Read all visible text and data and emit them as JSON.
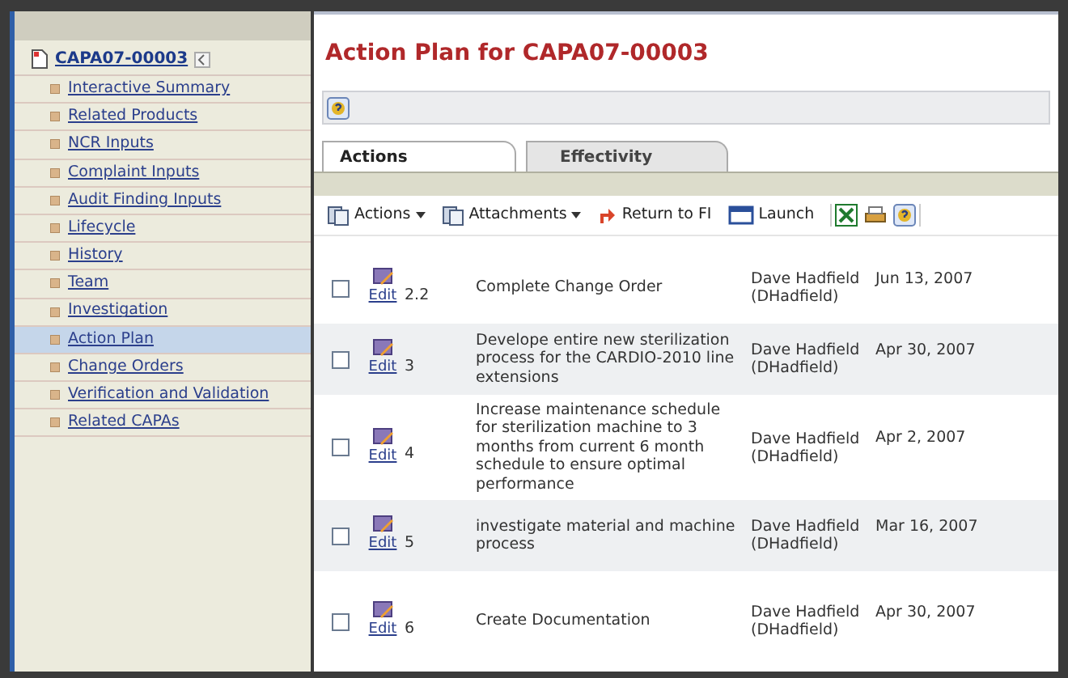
{
  "sidebar": {
    "record": "CAPA07-00003",
    "items": [
      {
        "label": "Interactive Summary",
        "selected": false
      },
      {
        "label": "Related Products",
        "selected": false
      },
      {
        "label": "NCR Inputs",
        "selected": false
      },
      {
        "label": "Complaint Inputs",
        "selected": false
      },
      {
        "label": "Audit Finding Inputs",
        "selected": false
      },
      {
        "label": "Lifecycle",
        "selected": false
      },
      {
        "label": "History",
        "selected": false
      },
      {
        "label": "Team",
        "selected": false
      },
      {
        "label": "Investigation",
        "selected": false
      },
      {
        "label": "Action Plan",
        "selected": true
      },
      {
        "label": "Change Orders",
        "selected": false
      },
      {
        "label": "Verification and Validation",
        "selected": false
      },
      {
        "label": "Related CAPAs",
        "selected": false
      }
    ]
  },
  "title": "Action Plan for CAPA07-00003",
  "tabs": [
    {
      "label": "Actions",
      "selected": true
    },
    {
      "label": "Effectivity",
      "selected": false
    }
  ],
  "toolbar": [
    {
      "label": "Actions",
      "kind": "menu"
    },
    {
      "label": "Attachments",
      "kind": "menu"
    },
    {
      "label": "Return to FI",
      "kind": "return"
    },
    {
      "label": "Launch",
      "kind": "launch"
    }
  ],
  "rows": [
    {
      "checked": false,
      "edit": "Edit",
      "number": "2.2",
      "description": "Complete Change Order",
      "owner": "Dave Hadfield (DHadfield)",
      "date": "Jun 13, 2007"
    },
    {
      "checked": false,
      "edit": "Edit",
      "number": "3",
      "description": "Develope entire new sterilization process for the CARDIO-2010 line extensions",
      "owner": "Dave Hadfield (DHadfield)",
      "date": "Apr 30, 2007"
    },
    {
      "checked": false,
      "edit": "Edit",
      "number": "4",
      "description": "Increase maintenance schedule for sterilization machine to 3 months from current 6 month schedule to ensure optimal performance",
      "owner": "Dave Hadfield (DHadfield)",
      "date": "Apr 2, 2007"
    },
    {
      "checked": false,
      "edit": "Edit",
      "number": "5",
      "description": "investigate material and machine process",
      "owner": "Dave Hadfield (DHadfield)",
      "date": "Mar 16, 2007"
    },
    {
      "checked": false,
      "edit": "Edit",
      "number": "6",
      "description": "Create Documentation",
      "owner": "Dave Hadfield (DHadfield)",
      "date": "Apr 30, 2007"
    }
  ]
}
